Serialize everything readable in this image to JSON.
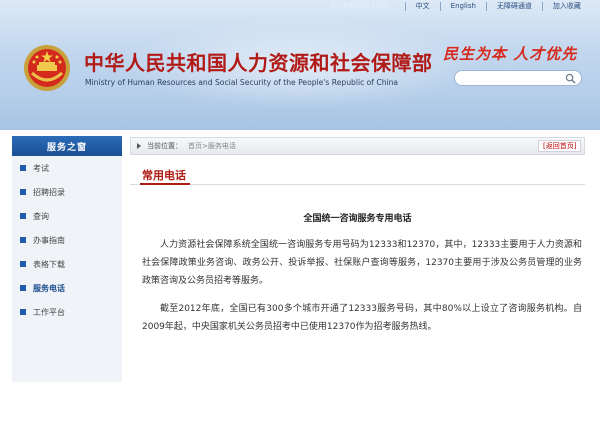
{
  "topbar": {
    "date": "2016年04月15日",
    "links": [
      "中文",
      "English",
      "无障碍通道",
      "加入收藏"
    ]
  },
  "header": {
    "title_cn": "中华人民共和国人力资源和社会保障部",
    "title_en": "Ministry of Human Resources and Social Security of the People's Republic of China",
    "slogan": "民生为本  人才优先",
    "search_placeholder": ""
  },
  "sidebar": {
    "heading": "服务之窗",
    "items": [
      {
        "label": "考试"
      },
      {
        "label": "招聘招录"
      },
      {
        "label": "查询"
      },
      {
        "label": "办事指南"
      },
      {
        "label": "表格下载"
      },
      {
        "label": "服务电话"
      },
      {
        "label": "工作平台"
      }
    ],
    "active_index": 5
  },
  "breadcrumb": {
    "label": "当前位置：",
    "path": "首页>服务电话",
    "back_label": "[返回首页]"
  },
  "content": {
    "section_title": "常用电话",
    "article_title": "全国统一咨询服务专用电话",
    "paragraphs": [
      "人力资源社会保障系统全国统一咨询服务专用号码为12333和12370，其中，12333主要用于人力资源和社会保障政策业务咨询、政务公开、投诉举报、社保账户查询等服务，12370主要用于涉及公务员管理的业务政策咨询及公务员招考等服务。",
      "截至2012年底，全国已有300多个城市开通了12333服务号码，其中80%以上设立了咨询服务机构。自2009年起，中央国家机关公务员招考中已使用12370作为招考服务热线。"
    ]
  },
  "colors": {
    "brand_red": "#b11a16",
    "nav_blue": "#1f5ba8",
    "header_blue": "#b4cde9"
  }
}
